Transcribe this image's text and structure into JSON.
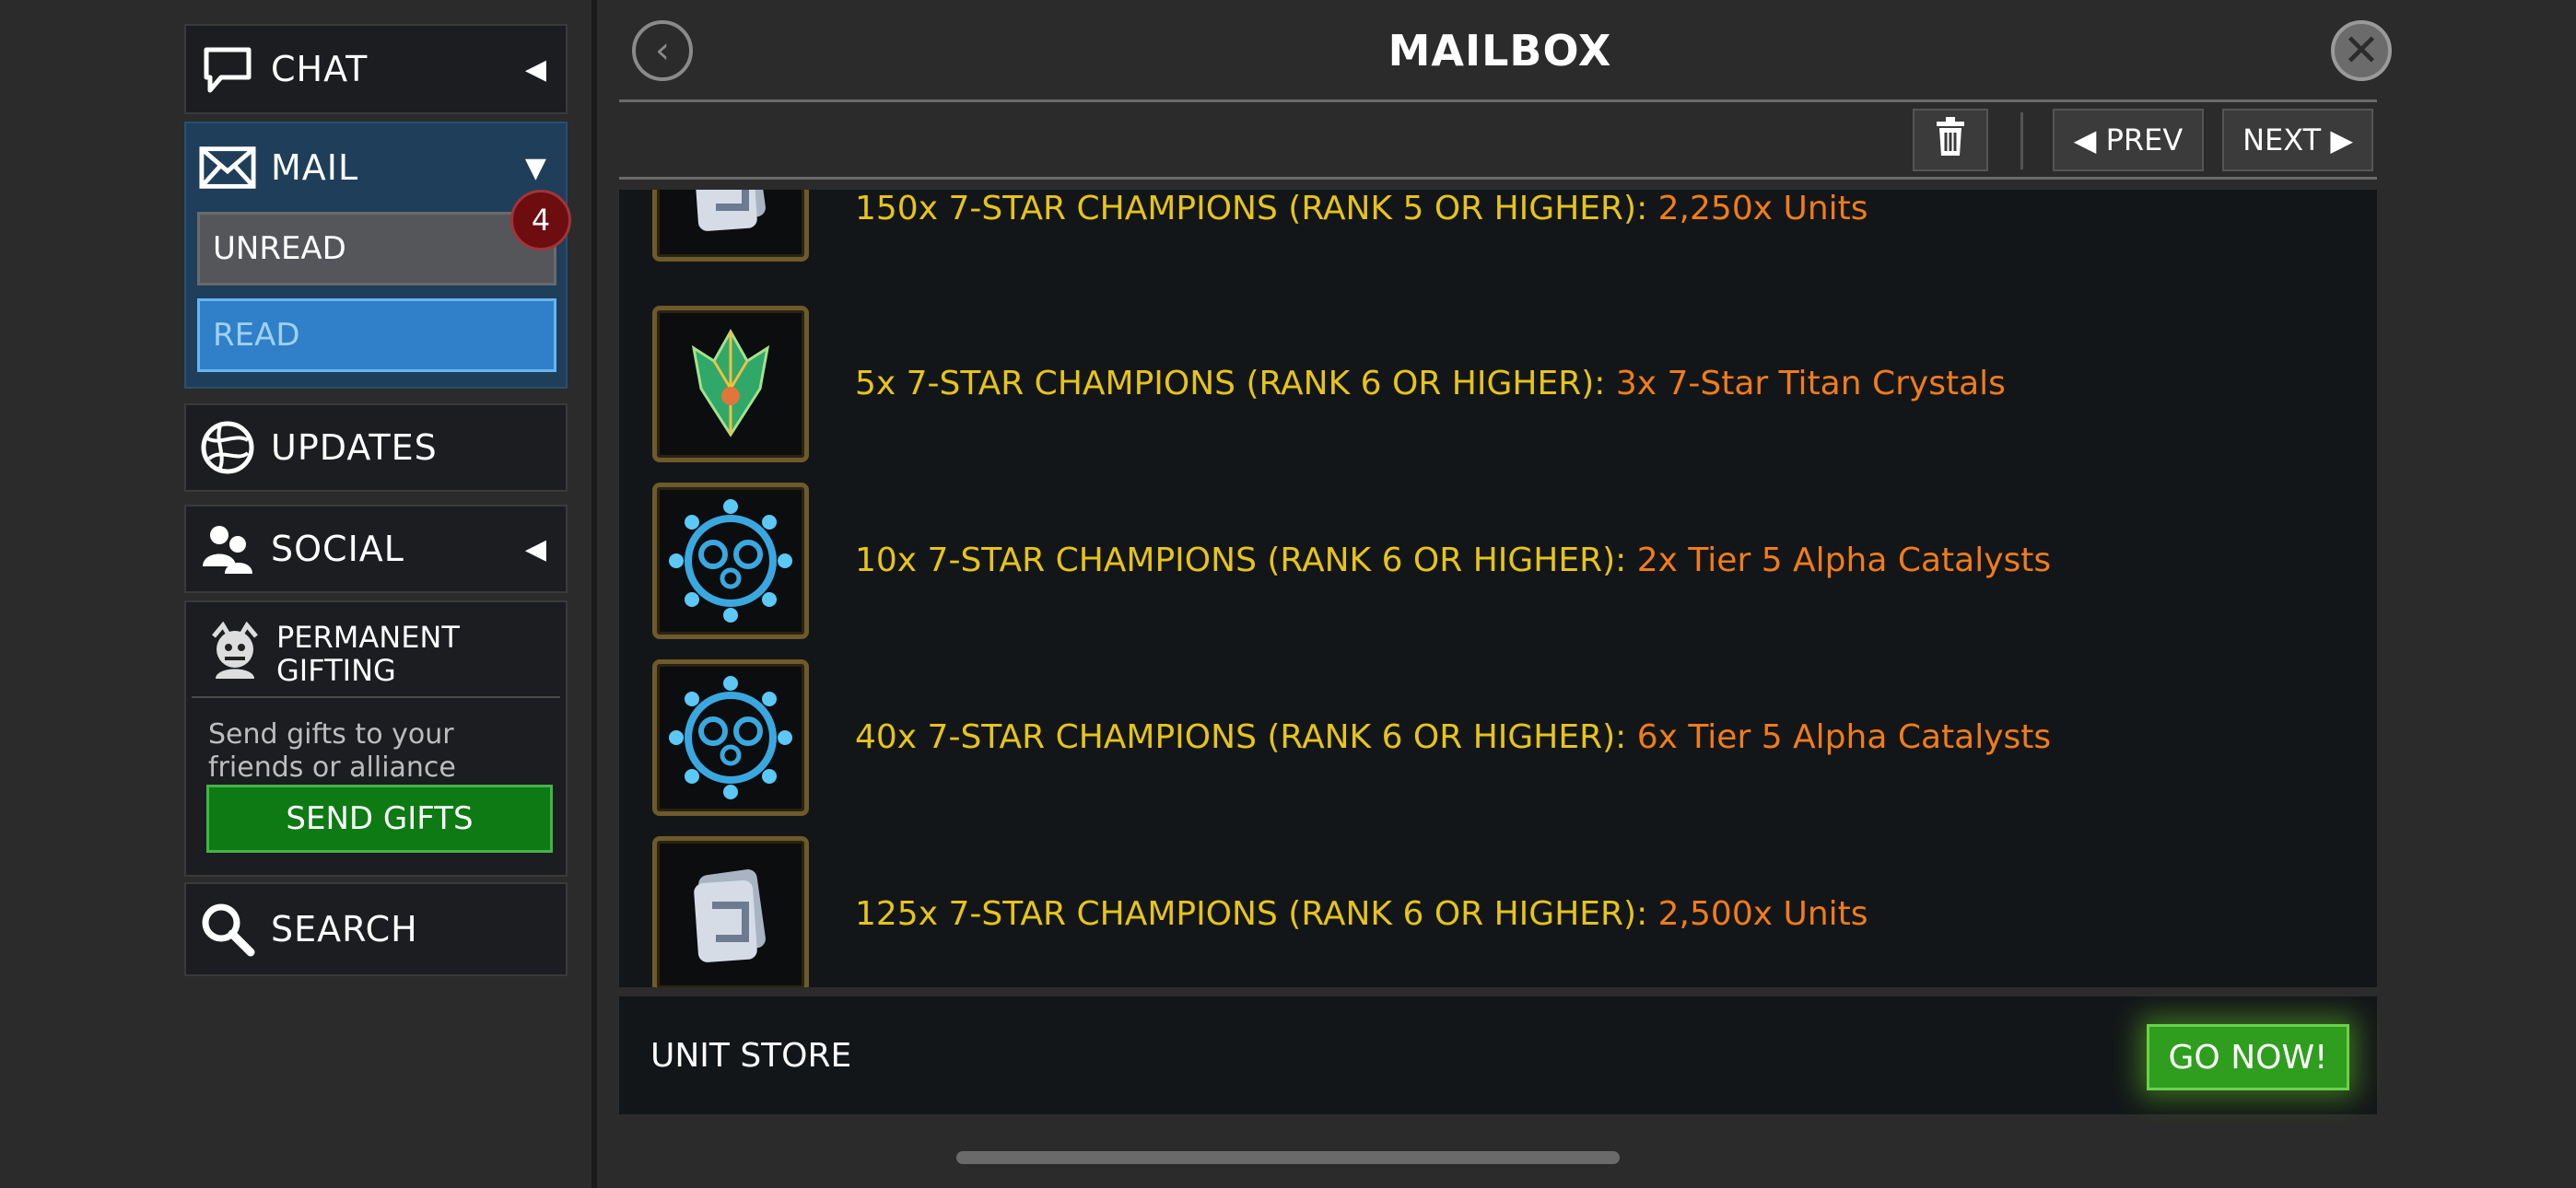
{
  "sidebar": {
    "chat_label": "CHAT",
    "mail_label": "MAIL",
    "unread_label": "UNREAD",
    "unread_count": "4",
    "read_label": "READ",
    "updates_label": "UPDATES",
    "social_label": "SOCIAL",
    "gifting_title_line1": "PERMANENT",
    "gifting_title_line2": "GIFTING",
    "gifting_desc": "Send gifts to your friends or alliance members.",
    "send_gifts_label": "SEND GIFTS",
    "search_label": "SEARCH"
  },
  "header": {
    "title": "MAILBOX",
    "prev_label": "◀ PREV",
    "next_label": "NEXT ▶"
  },
  "rewards": [
    {
      "requirement": "150x 7-STAR CHAMPIONS (RANK 5 OR HIGHER):",
      "reward": "2,250x Units",
      "icon": "units-icon"
    },
    {
      "requirement": "5x 7-STAR CHAMPIONS (RANK 6 OR HIGHER):",
      "reward": "3x 7-Star Titan Crystals",
      "icon": "titan-crystal-icon"
    },
    {
      "requirement": "10x 7-STAR CHAMPIONS (RANK 6 OR HIGHER):",
      "reward": "2x Tier 5 Alpha Catalysts",
      "icon": "alpha-catalyst-icon"
    },
    {
      "requirement": "40x 7-STAR CHAMPIONS (RANK 6 OR HIGHER):",
      "reward": "6x Tier 5 Alpha Catalysts",
      "icon": "alpha-catalyst-icon"
    },
    {
      "requirement": "125x 7-STAR CHAMPIONS (RANK 6 OR HIGHER):",
      "reward": "2,500x Units",
      "icon": "units-icon"
    }
  ],
  "footer": {
    "store_label": "UNIT STORE",
    "go_now_label": "GO NOW!"
  },
  "colors": {
    "requirement_text": "#e6c41a",
    "reward_text": "#f07c1a",
    "read_button": "#2f80c8",
    "send_gifts_button": "#0e7a14"
  }
}
